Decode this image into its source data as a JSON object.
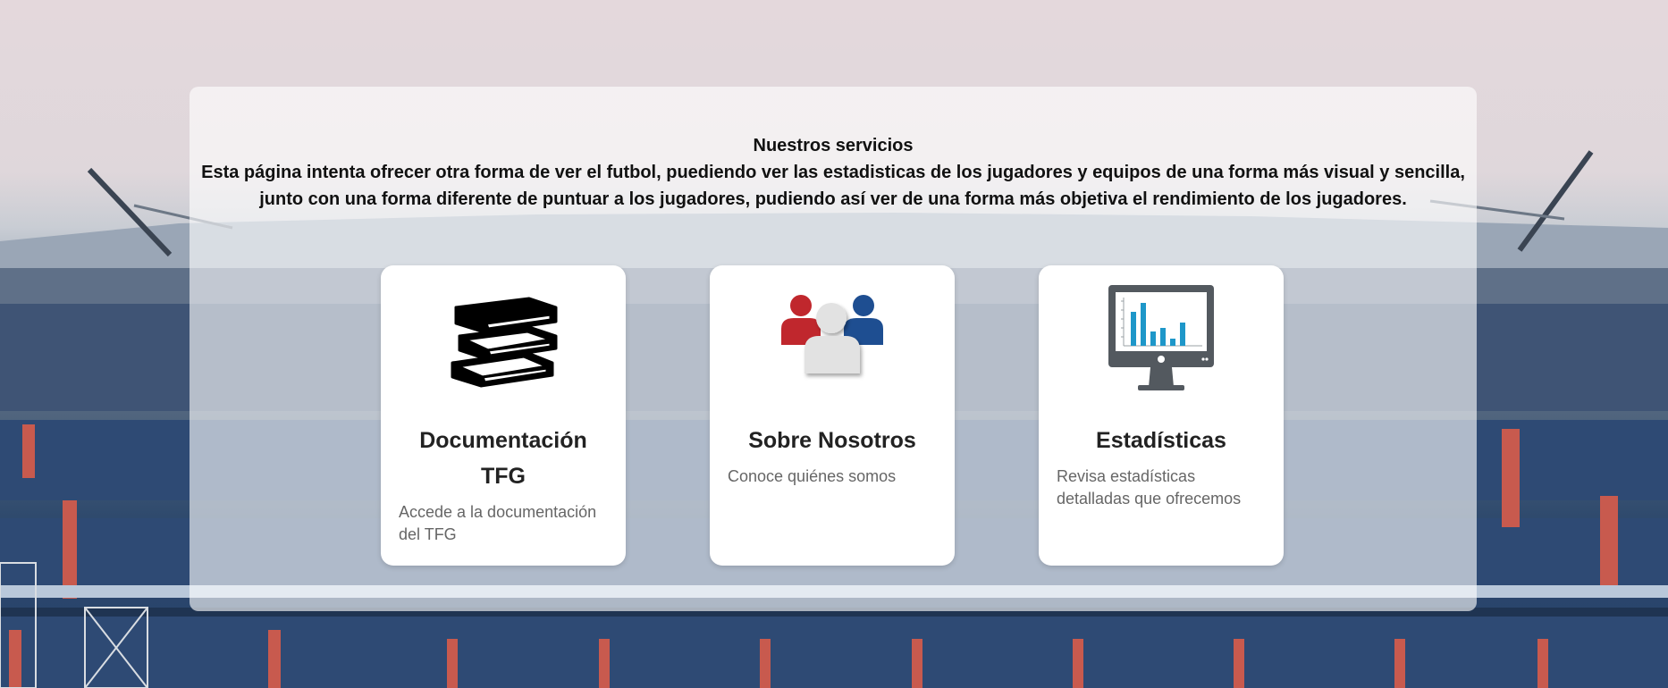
{
  "services": {
    "title": "Nuestros servicios",
    "description": "Esta página intenta ofrecer otra forma de ver el futbol, puediendo ver las estadisticas de los jugadores y equipos de una forma más visual y sencilla, junto con una forma diferente de puntuar a los jugadores, pudiendo así ver de una forma más objetiva el rendimiento de los jugadores."
  },
  "cards": [
    {
      "title": "Documentación TFG",
      "text": "Accede a la documentación del TFG",
      "icon": "books-icon"
    },
    {
      "title": "Sobre Nosotros",
      "text": "Conoce quiénes somos",
      "icon": "team-icon"
    },
    {
      "title": "Estadísticas",
      "text": "Revisa estadísticas detalladas que ofrecemos",
      "icon": "stats-monitor-icon"
    }
  ],
  "colors": {
    "team_red": "#c0272d",
    "team_blue": "#1e4e91",
    "chart_bar": "#1e97c9",
    "monitor": "#53595f"
  }
}
